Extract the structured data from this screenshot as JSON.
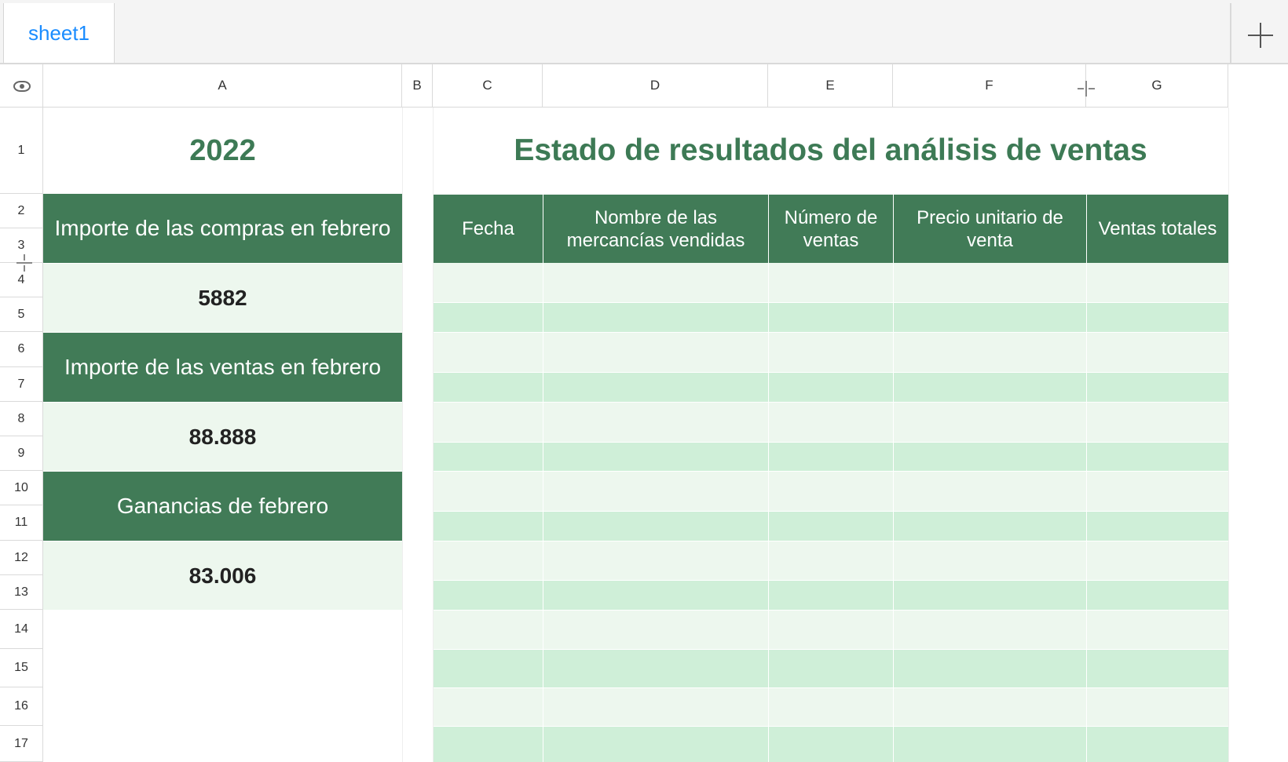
{
  "tabs": {
    "active": "sheet1"
  },
  "columns": [
    "A",
    "B",
    "C",
    "D",
    "E",
    "F",
    "G"
  ],
  "rows": [
    "1",
    "2",
    "3",
    "4",
    "5",
    "6",
    "7",
    "8",
    "9",
    "10",
    "11",
    "12",
    "13",
    "14",
    "15",
    "16",
    "17"
  ],
  "left_panel": {
    "year": "2022",
    "purchases_label": "Importe de las compras en febrero",
    "purchases_value": "5882",
    "sales_label": "Importe de las ventas en febrero",
    "sales_value": "88.888",
    "profit_label": "Ganancias de febrero",
    "profit_value": "83.006"
  },
  "table": {
    "title": "Estado de resultados del análisis de ventas",
    "headers": [
      "Fecha",
      "Nombre de las mercancías vendidas",
      "Número de ventas",
      "Precio unitario de venta",
      "Ventas totales"
    ]
  },
  "colors": {
    "header_green": "#417b57",
    "title_green": "#3d7a55",
    "row_light": "#edf7ee",
    "row_mid": "#cfefd8",
    "tab_blue": "#1a8cff"
  }
}
